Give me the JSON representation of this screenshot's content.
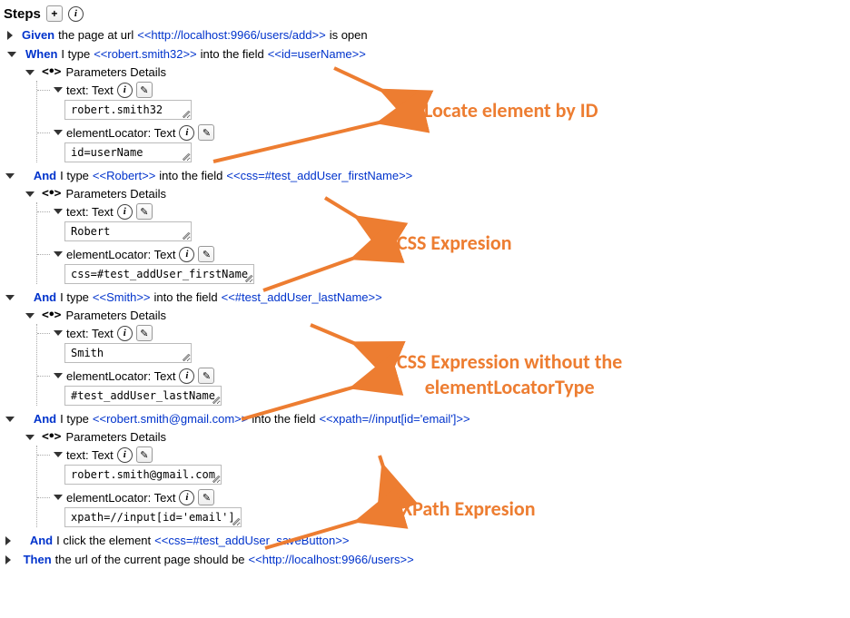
{
  "header": {
    "title": "Steps",
    "add_label": "+",
    "info_label": "i"
  },
  "params_header": "Parameters Details",
  "steps": [
    {
      "keyword": "Given",
      "pre": "the page at url",
      "param_a": "<<http://localhost:9966/users/add>>",
      "mid": "is open",
      "param_b": "",
      "expanded": false,
      "details": null
    },
    {
      "keyword": "When",
      "pre": "I type",
      "param_a": "<<robert.smith32>>",
      "mid": "into the field",
      "param_b": "<<id=userName>>",
      "expanded": true,
      "details": {
        "text_label": "text: Text",
        "text_value": "robert.smith32",
        "loc_label": "elementLocator: Text",
        "loc_value": "id=userName"
      }
    },
    {
      "keyword": "And",
      "pre": "I type",
      "param_a": "<<Robert>>",
      "mid": "into the field",
      "param_b": "<<css=#test_addUser_firstName>>",
      "expanded": true,
      "details": {
        "text_label": "text: Text",
        "text_value": "Robert",
        "loc_label": "elementLocator: Text",
        "loc_value": "css=#test_addUser_firstName"
      }
    },
    {
      "keyword": "And",
      "pre": "I type",
      "param_a": "<<Smith>>",
      "mid": "into the field",
      "param_b": "<<#test_addUser_lastName>>",
      "expanded": true,
      "details": {
        "text_label": "text: Text",
        "text_value": "Smith",
        "loc_label": "elementLocator: Text",
        "loc_value": "#test_addUser_lastName"
      }
    },
    {
      "keyword": "And",
      "pre": "I type",
      "param_a": "<<robert.smith@gmail.com>>",
      "mid": "into the field",
      "param_b": "<<xpath=//input[id='email']>>",
      "expanded": true,
      "details": {
        "text_label": "text: Text",
        "text_value": "robert.smith@gmail.com",
        "loc_label": "elementLocator: Text",
        "loc_value": "xpath=//input[id='email']"
      }
    },
    {
      "keyword": "And",
      "pre": "I click the element",
      "param_a": "<<css=#test_addUser_saveButton>>",
      "mid": "",
      "param_b": "",
      "expanded": false,
      "details": null
    },
    {
      "keyword": "Then",
      "pre": "the url of the current page should be",
      "param_a": "<<http://localhost:9966/users>>",
      "mid": "",
      "param_b": "",
      "expanded": false,
      "details": null
    }
  ],
  "annotations": {
    "a1": "Locate element by ID",
    "a2": "CSS Expresion",
    "a3": "CSS Expression without the\nelementLocatorType",
    "a4": "XPath Expresion"
  }
}
